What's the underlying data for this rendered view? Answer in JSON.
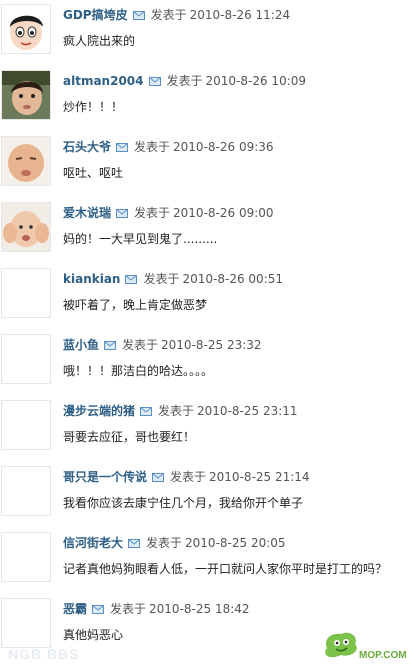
{
  "comments": [
    {
      "user": "GDP搞垮皮",
      "posted": "发表于",
      "time": "2010-8-26 11:24",
      "text": "疯人院出来的",
      "avatar": "cartoon-boy"
    },
    {
      "user": "altman2004",
      "posted": "发表于",
      "time": "2010-8-26 10:09",
      "text": "炒作！！！",
      "avatar": "child-photo"
    },
    {
      "user": "石头大爷",
      "posted": "发表于",
      "time": "2010-8-26 09:36",
      "text": "呕吐、呕吐",
      "avatar": "baby-grimace"
    },
    {
      "user": "爱木说瑞",
      "posted": "发表于",
      "time": "2010-8-26 09:00",
      "text": "妈的！一大早见到鬼了.........",
      "avatar": "baby-hands"
    },
    {
      "user": "kiankian",
      "posted": "发表于",
      "time": "2010-8-26 00:51",
      "text": "被吓着了，晚上肯定做恶梦",
      "avatar": "blank"
    },
    {
      "user": "蓝小鱼",
      "posted": "发表于",
      "time": "2010-8-25 23:32",
      "text": "哦！！！那洁白的哈达。。。。",
      "avatar": "blank"
    },
    {
      "user": "漫步云端的猪",
      "posted": "发表于",
      "time": "2010-8-25 23:11",
      "text": "哥要去应征，哥也要红！",
      "avatar": "blank"
    },
    {
      "user": "哥只是一个传说",
      "posted": "发表于",
      "time": "2010-8-25 21:14",
      "text": "我看你应该去康宁住几个月，我给你开个单子",
      "avatar": "blank"
    },
    {
      "user": "信河街老大",
      "posted": "发表于",
      "time": "2010-8-25 20:05",
      "text": "记者真他妈狗眼看人低，一开口就问人家你平时是打工的吗？",
      "avatar": "blank"
    },
    {
      "user": "恶霸",
      "posted": "发表于",
      "time": "2010-8-25 18:42",
      "text": "真他妈恶心",
      "avatar": "blank"
    }
  ],
  "watermark": {
    "left": "NGB BBS",
    "right": "MOP.COM"
  },
  "colors": {
    "username": "#2e5f86",
    "text": "#222222",
    "meta": "#555555",
    "mail_icon": "#5b8fc4"
  }
}
